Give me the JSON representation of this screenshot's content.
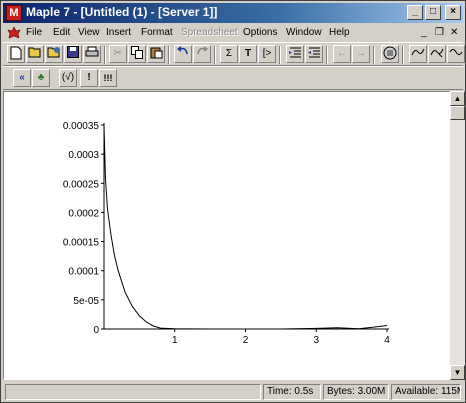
{
  "window": {
    "app_icon": "maple-leaf-icon",
    "title": "Maple 7 - [Untitled (1) - [Server 1]]",
    "controls": [
      "minimize-icon",
      "maximize-icon",
      "close-icon"
    ]
  },
  "menu": {
    "items": [
      {
        "label": "File",
        "enabled": true
      },
      {
        "label": "Edit",
        "enabled": true
      },
      {
        "label": "View",
        "enabled": true
      },
      {
        "label": "Insert",
        "enabled": true
      },
      {
        "label": "Format",
        "enabled": true
      },
      {
        "label": "Spreadsheet",
        "enabled": false
      },
      {
        "label": "Options",
        "enabled": true
      },
      {
        "label": "Window",
        "enabled": true
      },
      {
        "label": "Help",
        "enabled": true
      }
    ],
    "mdi_controls": [
      "_",
      "❐",
      "✕"
    ]
  },
  "toolbar1": {
    "icons": [
      "new-document-icon",
      "open-icon",
      "open-url-icon",
      "save-icon",
      "print-icon",
      "cut-icon",
      "copy-icon",
      "paste-icon",
      "undo-icon",
      "redo-icon",
      "sigma-icon",
      "text-icon",
      "prompt-icon",
      "indent-icon",
      "outdent-icon",
      "back-icon",
      "forward-icon",
      "stop-icon",
      "zoom-icon-1",
      "zoom-icon-2",
      "zoom-icon-3"
    ],
    "glyphs": {
      "cut": "✂",
      "sigma": "Σ",
      "text": "T",
      "prompt": "[>",
      "back": "←",
      "forward": "→"
    }
  },
  "toolbar2": {
    "glyphs": [
      "«",
      "♣",
      "(√)",
      "!",
      "!!!"
    ]
  },
  "plot": {
    "chart_data": {
      "type": "line",
      "title": "",
      "xlabel": "",
      "ylabel": "",
      "xlim": [
        0,
        4
      ],
      "ylim": [
        0,
        0.00035
      ],
      "x_ticks": [
        "1",
        "2",
        "3",
        "4"
      ],
      "y_ticks": [
        "0",
        "5e-05",
        "0.0001",
        "0.00015",
        "0.0002",
        "0.00025",
        "0.0003",
        "0.00035"
      ],
      "y_tick_values": [
        0,
        5e-05,
        0.0001,
        0.00015,
        0.0002,
        0.00025,
        0.0003,
        0.00035
      ],
      "series": [
        {
          "x": [
            0.0,
            0.02,
            0.05,
            0.1,
            0.15,
            0.2,
            0.3,
            0.4,
            0.5,
            0.6,
            0.7,
            0.8,
            1.0,
            1.5,
            2.0,
            2.5,
            3.0,
            3.3,
            3.6,
            3.8,
            4.0
          ],
          "y": [
            0.00035,
            0.00026,
            0.000205,
            0.00016,
            0.000125,
            0.0001,
            6.25e-05,
            3.9e-05,
            2.25e-05,
            1.2e-05,
            5e-06,
            1.5e-06,
            5e-07,
            0.0,
            0.0,
            0.0,
            1e-06,
            2e-06,
            5e-07,
            3e-06,
            6e-06
          ]
        }
      ],
      "grid": false
    }
  },
  "status": {
    "time": "Time: 0.5s",
    "bytes": "Bytes: 3.00M",
    "available": "Available: 115M"
  }
}
